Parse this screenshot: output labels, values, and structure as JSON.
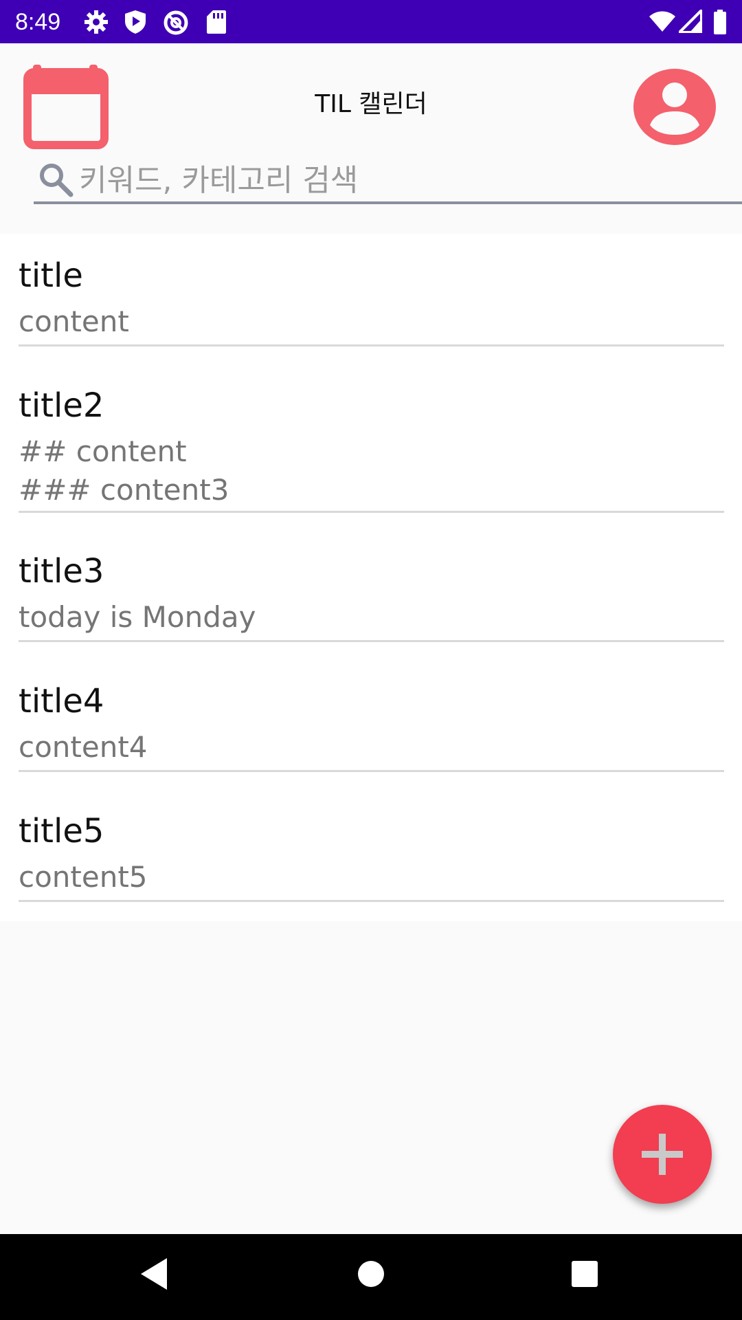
{
  "status_bar": {
    "time": "8:49",
    "left_icons": [
      "settings-icon",
      "play-protect-icon",
      "vpn-icon",
      "sd-card-icon"
    ],
    "right_icons": [
      "wifi-icon",
      "signal-icon",
      "battery-icon"
    ],
    "background": "#3f00b5"
  },
  "app_bar": {
    "title": "TIL 캘린더",
    "calendar_icon": "calendar-icon",
    "profile_icon": "account-circle-icon",
    "accent_color": "#f4606c"
  },
  "search": {
    "placeholder": "키워드, 카테고리 검색",
    "value": ""
  },
  "posts": [
    {
      "title": "title",
      "content": "content"
    },
    {
      "title": "title2",
      "content": "## content\n### content3"
    },
    {
      "title": "title3",
      "content": "today is Monday"
    },
    {
      "title": "title4",
      "content": "content4"
    },
    {
      "title": "title5",
      "content": "content5"
    }
  ],
  "fab": {
    "icon": "add-icon",
    "color": "#f23e50"
  },
  "nav_bar": {
    "buttons": [
      "back-icon",
      "home-icon",
      "recents-icon"
    ]
  }
}
